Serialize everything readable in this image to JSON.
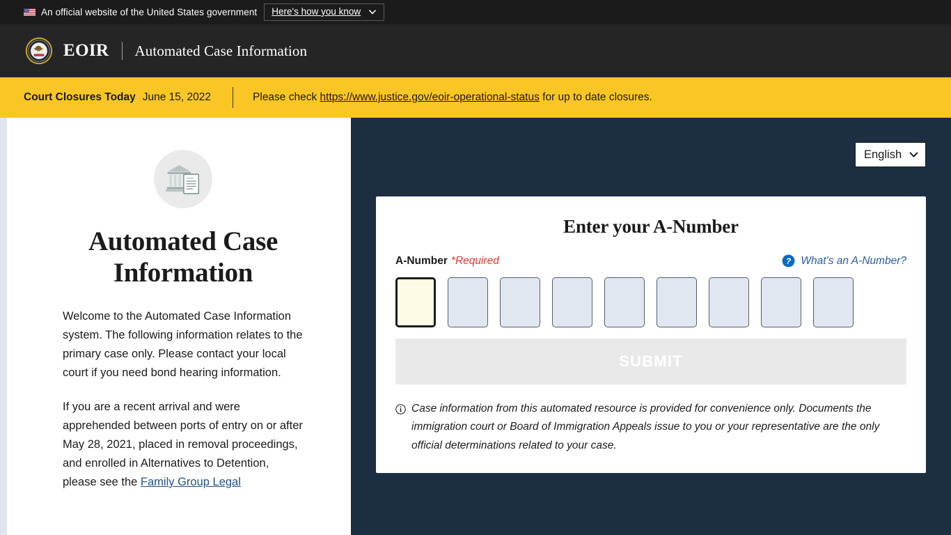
{
  "usa_banner": {
    "flag_icon": "us-flag-icon",
    "text": "An official website of the United States government",
    "button_label": "Here's how you know",
    "chevron_icon": "chevron-down-icon"
  },
  "header": {
    "seal_icon": "doj-seal-icon",
    "brand": "EOIR",
    "subtitle": "Automated Case Information"
  },
  "alert": {
    "title": "Court Closures Today",
    "date": "June 15, 2022",
    "message_before": "Please check ",
    "link_text": "https://www.justice.gov/eoir-operational-status",
    "message_after": " for up to date closures."
  },
  "left_panel": {
    "icon": "courthouse-document-icon",
    "title": "Automated Case Information",
    "paragraph_1": "Welcome to the Automated Case Information system. The following information relates to the primary case only. Please contact your local court if you need bond hearing information.",
    "paragraph_2_before": "If you are a recent arrival and were apprehended between ports of entry on or after May 28, 2021, placed in removal proceedings, and enrolled in Alternatives to Detention, please see the ",
    "paragraph_2_link": "Family Group Legal"
  },
  "right_panel": {
    "language": {
      "selected": "English",
      "options": [
        "English"
      ],
      "chevron_icon": "chevron-down-icon"
    },
    "form": {
      "title": "Enter your A-Number",
      "field_label": "A-Number",
      "required_text": "*Required",
      "help_icon": "question-mark-circle-icon",
      "help_text": "What’s an A-Number?",
      "digit_groups": [
        [
          "",
          "",
          ""
        ],
        [
          "",
          "",
          ""
        ],
        [
          "",
          "",
          ""
        ]
      ],
      "focused_index": 0,
      "submit_label": "SUBMIT",
      "submit_disabled": true,
      "disclaimer_icon": "info-circle-icon",
      "disclaimer": "Case information from this automated resource is provided for convenience only. Documents the immigration court or Board of Immigration Appeals issue to you or your representative are the only official determinations related to your case."
    }
  },
  "colors": {
    "banner_bg": "#1b1b1b",
    "header_bg": "#252525",
    "alert_bg": "#f9c626",
    "panel_bg": "#1c2e42",
    "focus_fill": "#fdfae6",
    "digit_fill": "#e1e7f1",
    "required_red": "#d83933",
    "link_blue": "#2b5c9b"
  }
}
